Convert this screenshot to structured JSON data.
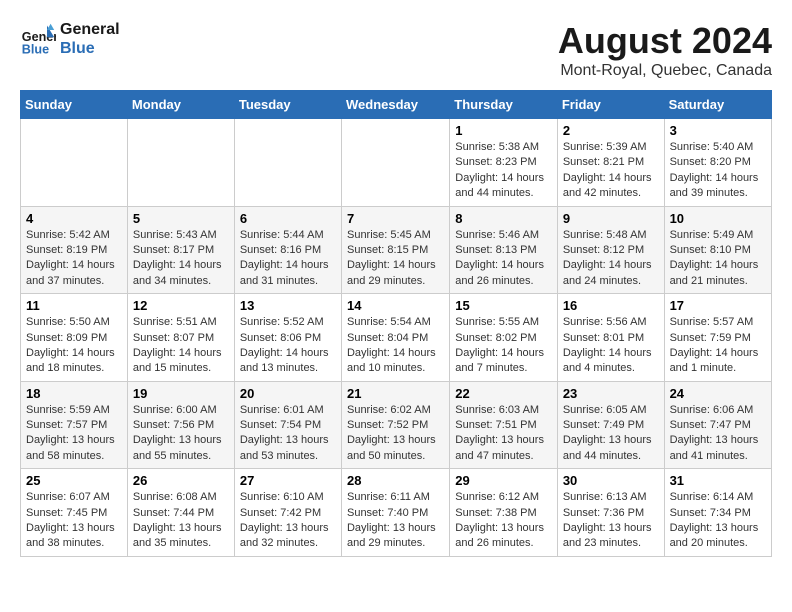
{
  "header": {
    "logo_line1": "General",
    "logo_line2": "Blue",
    "month_year": "August 2024",
    "location": "Mont-Royal, Quebec, Canada"
  },
  "days_of_week": [
    "Sunday",
    "Monday",
    "Tuesday",
    "Wednesday",
    "Thursday",
    "Friday",
    "Saturday"
  ],
  "weeks": [
    [
      {
        "num": "",
        "info": ""
      },
      {
        "num": "",
        "info": ""
      },
      {
        "num": "",
        "info": ""
      },
      {
        "num": "",
        "info": ""
      },
      {
        "num": "1",
        "info": "Sunrise: 5:38 AM\nSunset: 8:23 PM\nDaylight: 14 hours and 44 minutes."
      },
      {
        "num": "2",
        "info": "Sunrise: 5:39 AM\nSunset: 8:21 PM\nDaylight: 14 hours and 42 minutes."
      },
      {
        "num": "3",
        "info": "Sunrise: 5:40 AM\nSunset: 8:20 PM\nDaylight: 14 hours and 39 minutes."
      }
    ],
    [
      {
        "num": "4",
        "info": "Sunrise: 5:42 AM\nSunset: 8:19 PM\nDaylight: 14 hours and 37 minutes."
      },
      {
        "num": "5",
        "info": "Sunrise: 5:43 AM\nSunset: 8:17 PM\nDaylight: 14 hours and 34 minutes."
      },
      {
        "num": "6",
        "info": "Sunrise: 5:44 AM\nSunset: 8:16 PM\nDaylight: 14 hours and 31 minutes."
      },
      {
        "num": "7",
        "info": "Sunrise: 5:45 AM\nSunset: 8:15 PM\nDaylight: 14 hours and 29 minutes."
      },
      {
        "num": "8",
        "info": "Sunrise: 5:46 AM\nSunset: 8:13 PM\nDaylight: 14 hours and 26 minutes."
      },
      {
        "num": "9",
        "info": "Sunrise: 5:48 AM\nSunset: 8:12 PM\nDaylight: 14 hours and 24 minutes."
      },
      {
        "num": "10",
        "info": "Sunrise: 5:49 AM\nSunset: 8:10 PM\nDaylight: 14 hours and 21 minutes."
      }
    ],
    [
      {
        "num": "11",
        "info": "Sunrise: 5:50 AM\nSunset: 8:09 PM\nDaylight: 14 hours and 18 minutes."
      },
      {
        "num": "12",
        "info": "Sunrise: 5:51 AM\nSunset: 8:07 PM\nDaylight: 14 hours and 15 minutes."
      },
      {
        "num": "13",
        "info": "Sunrise: 5:52 AM\nSunset: 8:06 PM\nDaylight: 14 hours and 13 minutes."
      },
      {
        "num": "14",
        "info": "Sunrise: 5:54 AM\nSunset: 8:04 PM\nDaylight: 14 hours and 10 minutes."
      },
      {
        "num": "15",
        "info": "Sunrise: 5:55 AM\nSunset: 8:02 PM\nDaylight: 14 hours and 7 minutes."
      },
      {
        "num": "16",
        "info": "Sunrise: 5:56 AM\nSunset: 8:01 PM\nDaylight: 14 hours and 4 minutes."
      },
      {
        "num": "17",
        "info": "Sunrise: 5:57 AM\nSunset: 7:59 PM\nDaylight: 14 hours and 1 minute."
      }
    ],
    [
      {
        "num": "18",
        "info": "Sunrise: 5:59 AM\nSunset: 7:57 PM\nDaylight: 13 hours and 58 minutes."
      },
      {
        "num": "19",
        "info": "Sunrise: 6:00 AM\nSunset: 7:56 PM\nDaylight: 13 hours and 55 minutes."
      },
      {
        "num": "20",
        "info": "Sunrise: 6:01 AM\nSunset: 7:54 PM\nDaylight: 13 hours and 53 minutes."
      },
      {
        "num": "21",
        "info": "Sunrise: 6:02 AM\nSunset: 7:52 PM\nDaylight: 13 hours and 50 minutes."
      },
      {
        "num": "22",
        "info": "Sunrise: 6:03 AM\nSunset: 7:51 PM\nDaylight: 13 hours and 47 minutes."
      },
      {
        "num": "23",
        "info": "Sunrise: 6:05 AM\nSunset: 7:49 PM\nDaylight: 13 hours and 44 minutes."
      },
      {
        "num": "24",
        "info": "Sunrise: 6:06 AM\nSunset: 7:47 PM\nDaylight: 13 hours and 41 minutes."
      }
    ],
    [
      {
        "num": "25",
        "info": "Sunrise: 6:07 AM\nSunset: 7:45 PM\nDaylight: 13 hours and 38 minutes."
      },
      {
        "num": "26",
        "info": "Sunrise: 6:08 AM\nSunset: 7:44 PM\nDaylight: 13 hours and 35 minutes."
      },
      {
        "num": "27",
        "info": "Sunrise: 6:10 AM\nSunset: 7:42 PM\nDaylight: 13 hours and 32 minutes."
      },
      {
        "num": "28",
        "info": "Sunrise: 6:11 AM\nSunset: 7:40 PM\nDaylight: 13 hours and 29 minutes."
      },
      {
        "num": "29",
        "info": "Sunrise: 6:12 AM\nSunset: 7:38 PM\nDaylight: 13 hours and 26 minutes."
      },
      {
        "num": "30",
        "info": "Sunrise: 6:13 AM\nSunset: 7:36 PM\nDaylight: 13 hours and 23 minutes."
      },
      {
        "num": "31",
        "info": "Sunrise: 6:14 AM\nSunset: 7:34 PM\nDaylight: 13 hours and 20 minutes."
      }
    ]
  ]
}
